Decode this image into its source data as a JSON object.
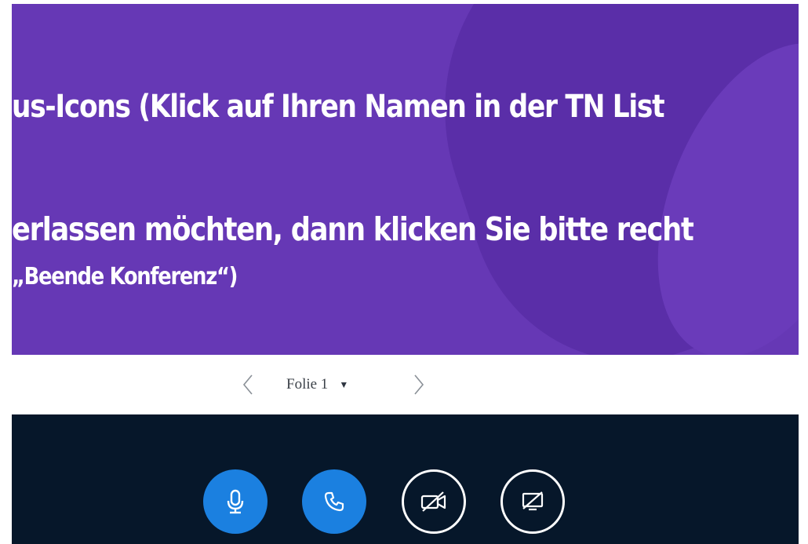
{
  "presentation": {
    "slide_lines": [
      "us-Icons (Klick auf Ihren Namen in der TN List",
      "erlassen möchten, dann klicken Sie bitte recht",
      "„Beende Konferenz“)"
    ],
    "background_color": "#6638b5"
  },
  "slide_nav": {
    "prev_icon": "chevron-left-icon",
    "current_slide_label": "Folie 1",
    "dropdown_icon": "caret-down-icon",
    "next_icon": "chevron-right-icon"
  },
  "action_bar": {
    "background_color": "#06172a",
    "accent_color": "#1b80e0",
    "buttons": [
      {
        "icon": "microphone-icon",
        "active": true
      },
      {
        "icon": "phone-icon",
        "active": true
      },
      {
        "icon": "video-off-icon",
        "active": false
      },
      {
        "icon": "screen-share-off-icon",
        "active": false
      }
    ]
  }
}
